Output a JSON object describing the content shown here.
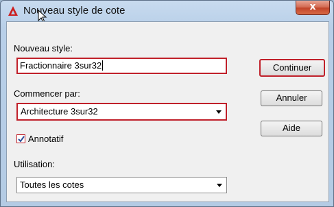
{
  "window": {
    "title": "Nouveau style de cote",
    "close_label": "x"
  },
  "fields": {
    "new_style_label": "Nouveau style:",
    "new_style_value": "Fractionnaire 3sur32",
    "start_with_label": "Commencer par:",
    "start_with_value": "Architecture 3sur32",
    "annotative_label": "Annotatif",
    "annotative_checked": true,
    "use_for_label": "Utilisation:",
    "use_for_value": "Toutes les cotes"
  },
  "buttons": {
    "continue": "Continuer",
    "cancel": "Annuler",
    "help": "Aide"
  },
  "colors": {
    "highlight": "#c0202a",
    "app_icon": "#cc1f1f"
  }
}
